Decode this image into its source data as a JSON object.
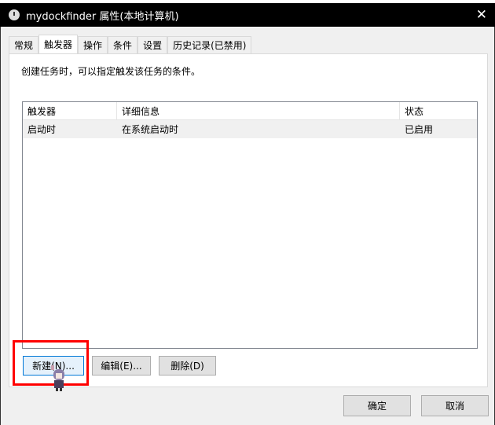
{
  "window": {
    "title": "mydockfinder 属性(本地计算机)",
    "close": "✕"
  },
  "tabs": [
    "常规",
    "触发器",
    "操作",
    "条件",
    "设置",
    "历史记录(已禁用)"
  ],
  "description": "创建任务时，可以指定触发该任务的条件。",
  "table": {
    "headers": [
      "触发器",
      "详细信息",
      "状态"
    ],
    "rows": [
      [
        "启动时",
        "在系统启动时",
        "已启用"
      ]
    ]
  },
  "buttons": {
    "new": "新建(N)...",
    "edit": "编辑(E)...",
    "delete": "删除(D)",
    "ok": "确定",
    "cancel": "取消"
  }
}
